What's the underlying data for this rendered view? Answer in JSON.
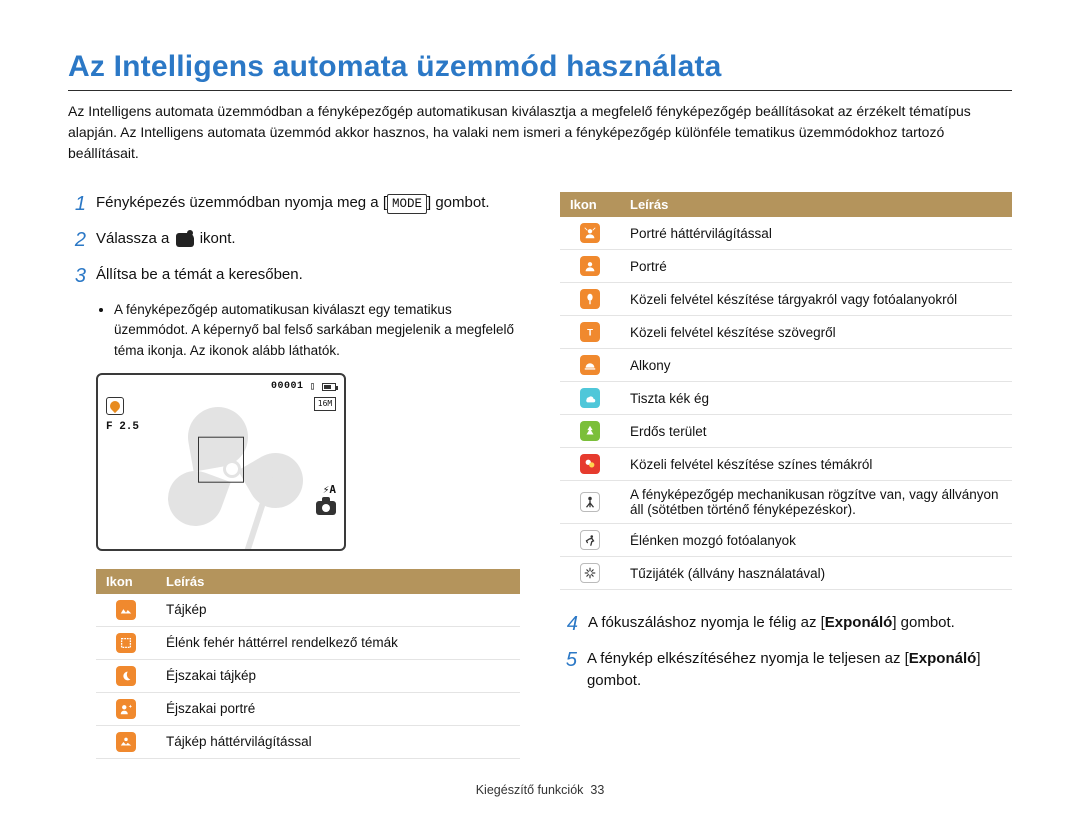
{
  "title": "Az Intelligens automata üzemmód használata",
  "intro": "Az Intelligens automata üzemmódban a fényképezőgép automatikusan kiválasztja a megfelelő fényképezőgép beállításokat az érzékelt tématípus alapján. Az Intelligens automata üzemmód akkor hasznos, ha valaki nem ismeri a fényképezőgép különféle tematikus üzemmódokhoz tartozó beállításait.",
  "step1a": "Fényképezés üzemmódban nyomja meg a [",
  "step1b": "] gombot.",
  "mode_label": "MODE",
  "step2a": "Válassza a ",
  "step2b": " ikont.",
  "step3": "Állítsa be a témát a keresőben.",
  "step3_sub": "A fényképezőgép automatikusan kiválaszt egy tematikus üzemmódot. A képernyő bal felső sarkában megjelenik a megfelelő téma ikonja. Az ikonok alább láthatók.",
  "step4a": "A fókuszáláshoz nyomja le félig az [",
  "step4b": "] gombot.",
  "step5a": "A fénykép elkészítéséhez nyomja le teljesen az [",
  "step5b": "] gombot.",
  "shutter_label": "Exponáló",
  "preview": {
    "counter": "00001",
    "f": "F 2.5",
    "size": "16M",
    "flash": "⚡A"
  },
  "table_hdr_ikon": "Ikon",
  "table_hdr_leiras": "Leírás",
  "left_table": [
    {
      "icon": "landscape",
      "bg": "orange",
      "desc": "Tájkép"
    },
    {
      "icon": "white-bg",
      "bg": "orange",
      "desc": "Élénk fehér háttérrel rendelkező témák"
    },
    {
      "icon": "night-land",
      "bg": "orange",
      "desc": "Éjszakai tájkép"
    },
    {
      "icon": "night-port",
      "bg": "orange",
      "desc": "Éjszakai portré"
    },
    {
      "icon": "land-back",
      "bg": "orange",
      "desc": "Tájkép háttérvilágítással"
    }
  ],
  "right_table": [
    {
      "icon": "port-back",
      "bg": "orange",
      "desc": "Portré háttérvilágítással"
    },
    {
      "icon": "portrait",
      "bg": "orange",
      "desc": "Portré"
    },
    {
      "icon": "macro",
      "bg": "orange",
      "desc": "Közeli felvétel készítése tárgyakról vagy fotóalanyokról"
    },
    {
      "icon": "text",
      "bg": "orange",
      "desc": "Közeli felvétel készítése szövegről"
    },
    {
      "icon": "sunset",
      "bg": "orange",
      "desc": "Alkony"
    },
    {
      "icon": "sky",
      "bg": "cyan",
      "desc": "Tiszta kék ég"
    },
    {
      "icon": "forest",
      "bg": "green",
      "desc": "Erdős terület"
    },
    {
      "icon": "color-macro",
      "bg": "red",
      "desc": "Közeli felvétel készítése színes témákról"
    },
    {
      "icon": "tripod",
      "bg": "white",
      "desc": "A fényképezőgép mechanikusan rögzítve van, vagy állványon áll (sötétben történő fényképezéskor)."
    },
    {
      "icon": "action",
      "bg": "white",
      "desc": "Élénken mozgó fotóalanyok"
    },
    {
      "icon": "firework",
      "bg": "white",
      "desc": "Tűzijáték (állvány használatával)"
    }
  ],
  "footer_section": "Kiegészítő funkciók",
  "footer_page": "33"
}
